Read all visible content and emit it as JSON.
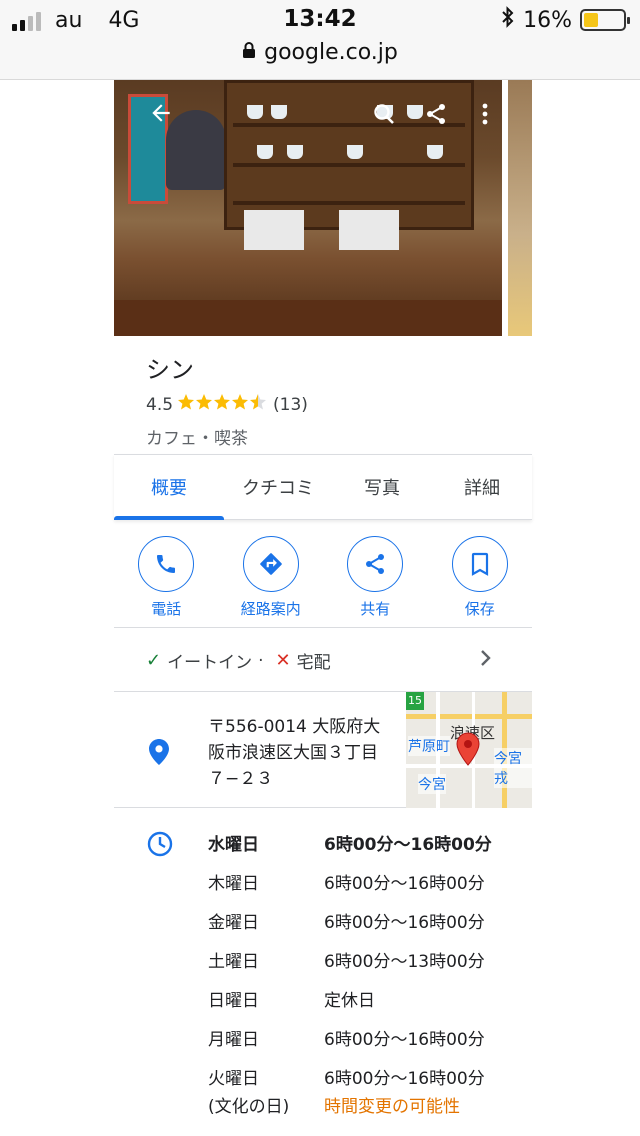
{
  "status": {
    "carrier": "au",
    "network": "4G",
    "time": "13:42",
    "battery": "16%",
    "battery_level": 0.16,
    "url": "google.co.jp"
  },
  "photo": {
    "back_icon": "back-arrow-icon",
    "search_icon": "search-icon",
    "share_icon": "share-icon",
    "more_icon": "more-vert-icon"
  },
  "place": {
    "name": "シン",
    "rating": "4.5",
    "stars": 4.5,
    "reviews": "(13)",
    "category": "カフェ・喫茶"
  },
  "tabs": [
    {
      "label": "概要",
      "active": true
    },
    {
      "label": "クチコミ",
      "active": false
    },
    {
      "label": "写真",
      "active": false
    },
    {
      "label": "詳細",
      "active": false
    }
  ],
  "actions": [
    {
      "label": "電話",
      "icon": "phone-icon"
    },
    {
      "label": "経路案内",
      "icon": "directions-icon"
    },
    {
      "label": "共有",
      "icon": "share-icon"
    },
    {
      "label": "保存",
      "icon": "bookmark-icon"
    }
  ],
  "services": {
    "dine_in": "イートイン",
    "separator": "·",
    "delivery": "宅配"
  },
  "address": {
    "line1": "〒556-0014 大阪府大",
    "line2": "阪市浪速区大国３丁目",
    "line3": "７−２３",
    "map_labels": {
      "route": "15",
      "district": "浪速区",
      "station1": "芦原町",
      "station2": "今宮",
      "station3": "今宮戎"
    }
  },
  "hours": [
    {
      "day": "水曜日",
      "time": "6時00分～16時00分",
      "bold": true
    },
    {
      "day": "木曜日",
      "time": "6時00分～16時00分"
    },
    {
      "day": "金曜日",
      "time": "6時00分～16時00分"
    },
    {
      "day": "土曜日",
      "time": "6時00分～13時00分"
    },
    {
      "day": "日曜日",
      "time": "定休日"
    },
    {
      "day": "月曜日",
      "time": "6時00分～16時00分"
    },
    {
      "day": "火曜日",
      "time": "6時00分～16時00分"
    }
  ],
  "holiday_note": {
    "label": "(文化の日)",
    "text": "時間変更の可能性"
  }
}
